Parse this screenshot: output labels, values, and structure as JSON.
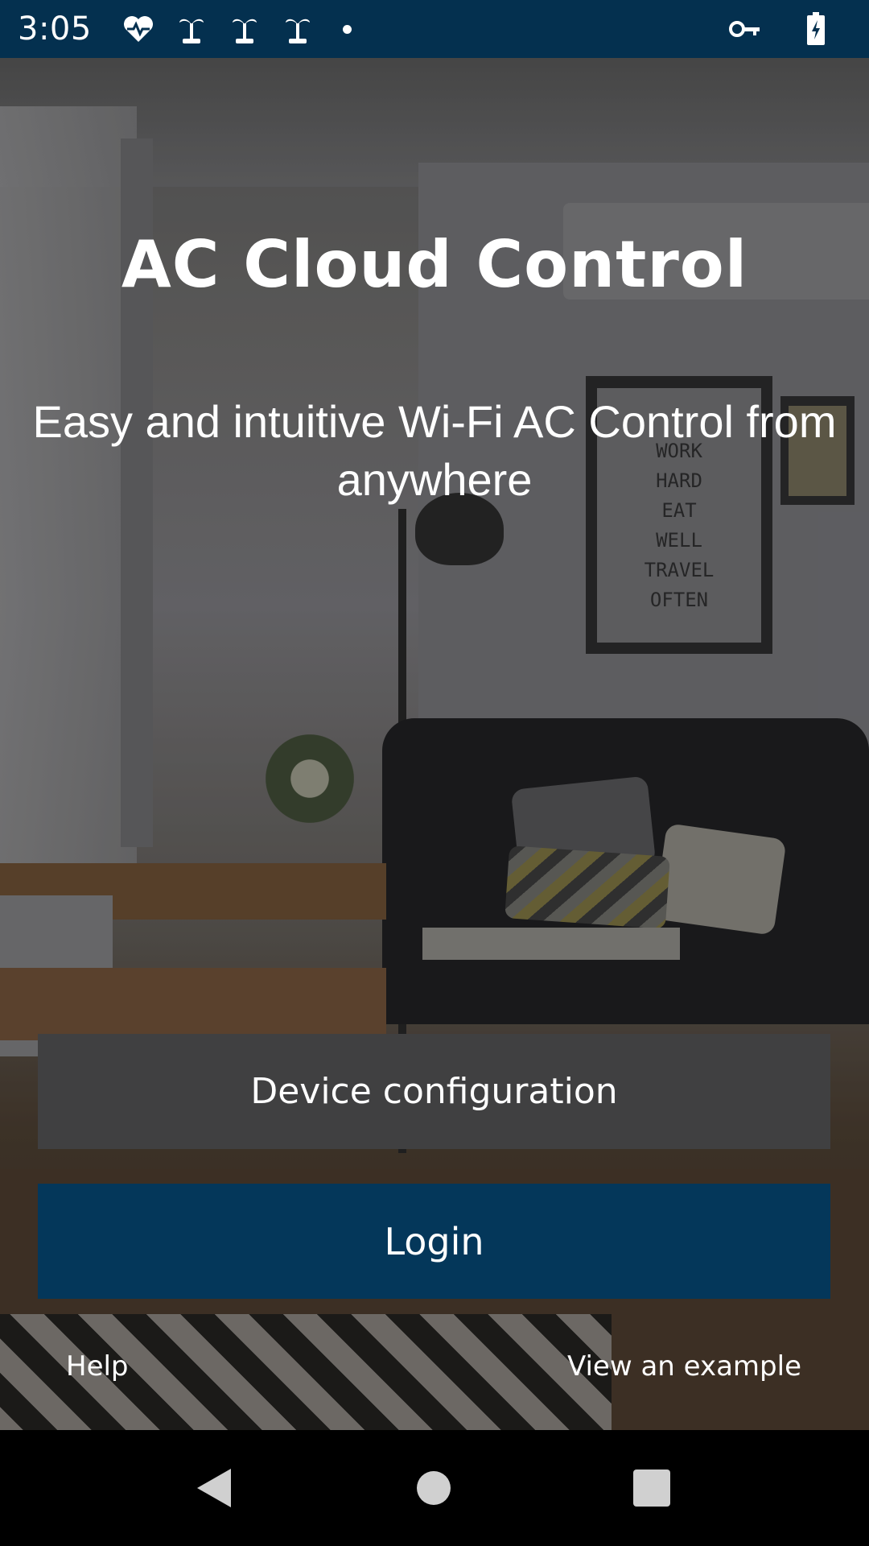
{
  "status_bar": {
    "time": "3:05",
    "left_icons": [
      "heart-pulse-icon",
      "palm-tree-icon",
      "palm-tree-icon",
      "palm-tree-icon",
      "dot-icon"
    ],
    "right_icons": [
      "vpn-key-icon",
      "battery-charging-icon"
    ]
  },
  "app": {
    "title": "AC Cloud Control",
    "tagline": "Easy and intuitive Wi-Fi AC Control from anywhere"
  },
  "background": {
    "poster_text": [
      "WORK",
      "HARD",
      "EAT",
      "WELL",
      "TRAVEL",
      "OFTEN"
    ]
  },
  "actions": {
    "device_configuration": "Device configuration",
    "login": "Login"
  },
  "links": {
    "help": "Help",
    "view_example": "View an example"
  },
  "nav_bar": {
    "icons": [
      "back-icon",
      "home-icon",
      "recent-apps-icon"
    ]
  },
  "colors": {
    "status_bar_bg": "#04304f",
    "login_bg": "#04375a",
    "device_config_bg": "#404041",
    "text": "#ffffff"
  }
}
